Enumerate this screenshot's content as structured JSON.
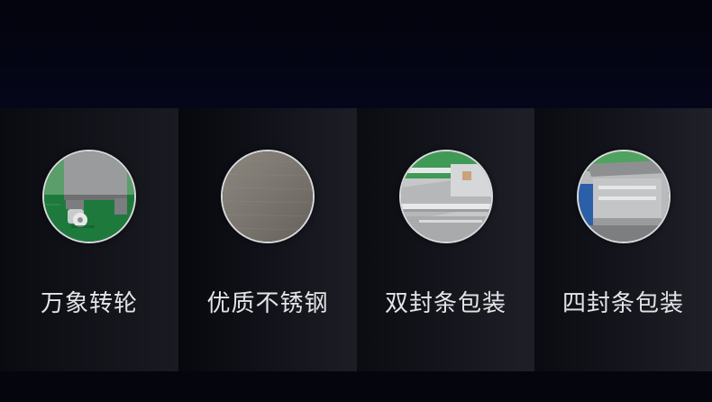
{
  "features": [
    {
      "label": "万象转轮",
      "image": "caster-wheel-photo"
    },
    {
      "label": "优质不锈钢",
      "image": "stainless-steel-photo"
    },
    {
      "label": "双封条包装",
      "image": "double-seal-bar-photo"
    },
    {
      "label": "四封条包装",
      "image": "four-seal-bar-photo"
    }
  ],
  "colors": {
    "background": "#04050d",
    "label_text": "#e4e4e6",
    "circle_border": "#d8d9dc"
  }
}
